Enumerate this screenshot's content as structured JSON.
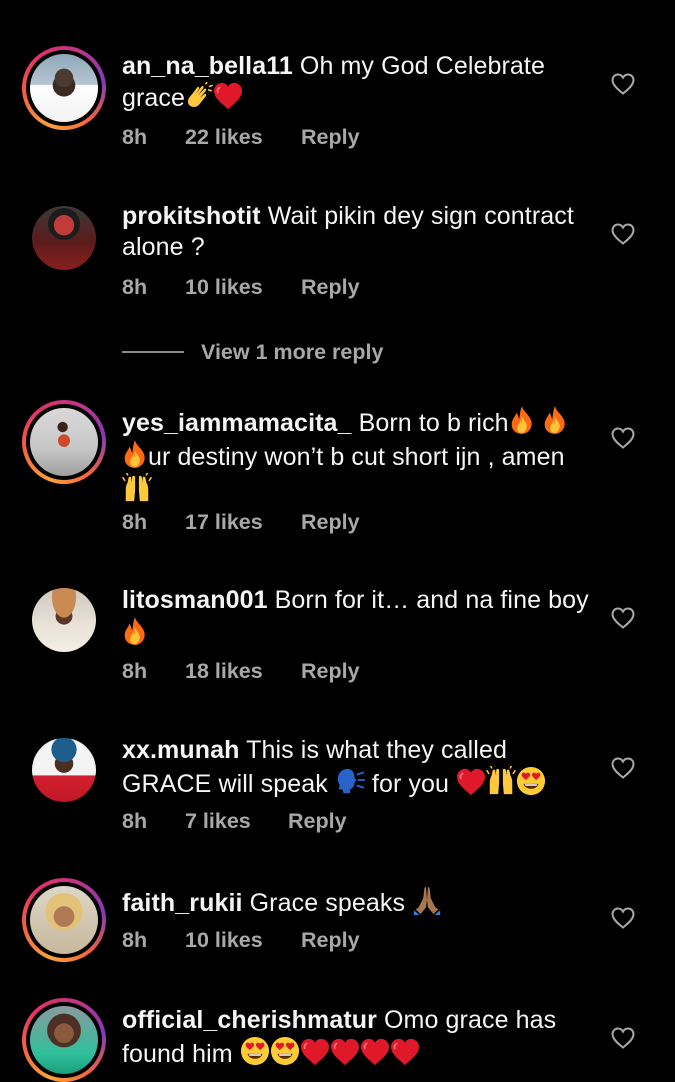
{
  "comments": [
    {
      "username": "an_na_bella11",
      "text": "Oh my God Celebrate grace",
      "emojis": [
        "clapping-hands",
        "red-heart"
      ],
      "time": "8h",
      "likes": "22 likes",
      "reply": "Reply",
      "avatar_ring": "story"
    },
    {
      "username": "prokitshotit",
      "text": "Wait pikin dey sign contract alone ?",
      "emojis": [],
      "time": "8h",
      "likes": "10 likes",
      "reply": "Reply",
      "avatar_ring": "none"
    },
    {
      "username": "yes_iammamacita_",
      "text_a": "Born to b rich",
      "text_b": "ur destiny won’t b cut short ijn , amen",
      "emojis": [
        "fire",
        "fire",
        "fire",
        "raising-hands"
      ],
      "time": "8h",
      "likes": "17 likes",
      "reply": "Reply",
      "avatar_ring": "story"
    },
    {
      "username": "litosman001",
      "text": "Born for it… and na fine boy",
      "emojis": [
        "fire"
      ],
      "time": "8h",
      "likes": "18 likes",
      "reply": "Reply",
      "avatar_ring": "none"
    },
    {
      "username": "xx.munah",
      "text_a": "This is what they called GRACE will speak",
      "text_b": "for you",
      "emojis": [
        "speaking-head",
        "red-heart",
        "raising-hands",
        "heart-eyes"
      ],
      "time": "8h",
      "likes": "7 likes",
      "reply": "Reply",
      "avatar_ring": "none"
    },
    {
      "username": "faith_rukii",
      "text": "Grace speaks",
      "emojis": [
        "folded-hands"
      ],
      "time": "8h",
      "likes": "10 likes",
      "reply": "Reply",
      "avatar_ring": "story"
    },
    {
      "username": "official_cherishmatur",
      "text": "Omo grace has found him",
      "emojis": [
        "heart-eyes",
        "heart-eyes",
        "red-heart",
        "red-heart",
        "red-heart",
        "red-heart"
      ],
      "avatar_ring": "story"
    }
  ],
  "view_more_replies": "View 1 more reply",
  "colors": {
    "background": "#000000",
    "primary_text": "#f5f5f5",
    "secondary_text": "#a8a8a8",
    "heart_red": "#e0192a",
    "fire_orange": "#ff7a18"
  }
}
